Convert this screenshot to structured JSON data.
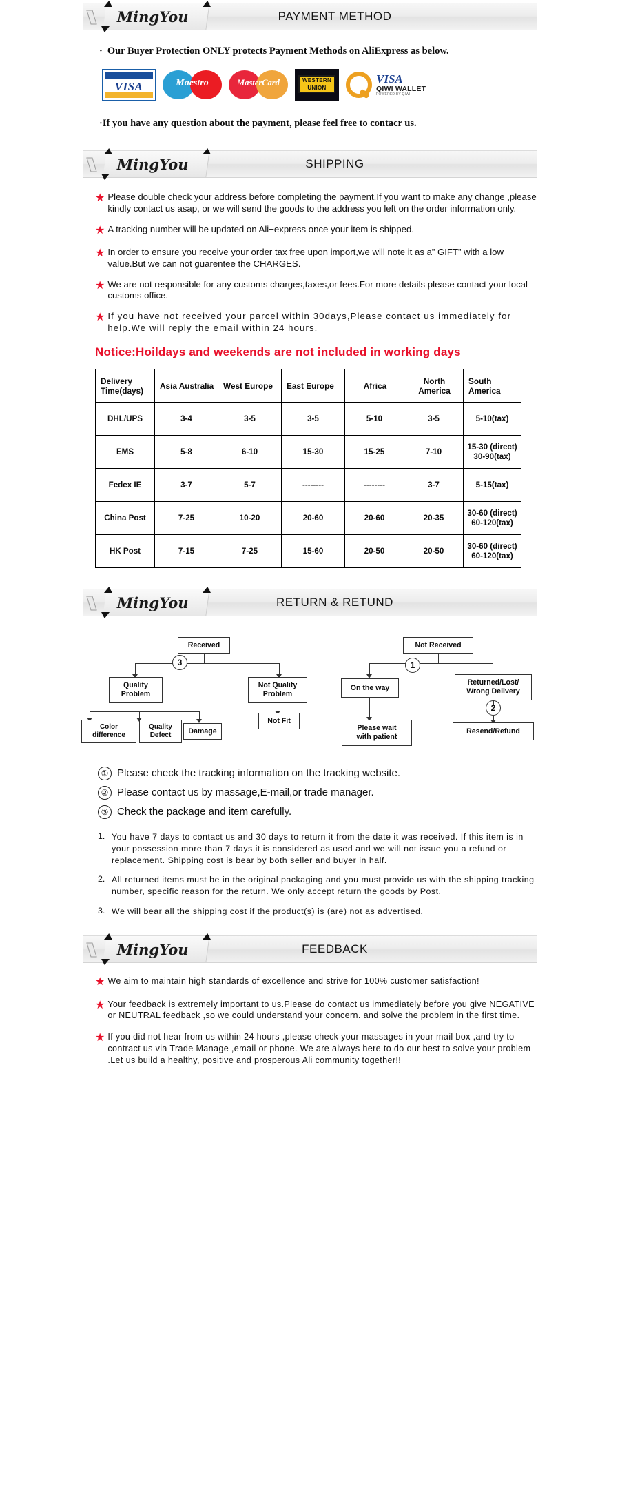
{
  "brand": "MingYou",
  "sections": {
    "payment": {
      "title": "PAYMENT METHOD",
      "line1": "Our Buyer Protection ONLY protects Payment Methods on AliExpress as below.",
      "line2": "If you have any question about the payment, please feel free to contacr us.",
      "bullet": "·",
      "logos": [
        {
          "name": "visa-logo",
          "text": "VISA"
        },
        {
          "name": "maestro-logo",
          "text": "Maestro"
        },
        {
          "name": "mastercard-logo",
          "text": "MasterCard"
        },
        {
          "name": "western-union-logo",
          "text_top": "WESTERN",
          "text_bottom": "UNION"
        },
        {
          "name": "qiwi-wallet-logo",
          "text": "VISA",
          "sub": "QIWI WALLET",
          "fine": "POWERED BY QIWI"
        }
      ]
    },
    "shipping": {
      "title": "SHIPPING",
      "bullets": [
        "Please double check your address before completing the payment.If you want to make any change ,please kindly contact us asap, or we will send the goods to the address you left on the order information only.",
        "A tracking number will be updated on Ali−express once your item is shipped.",
        "In order to ensure you receive your order tax free upon import,we will note it as a” GIFT” with a low value.But we can not guarentee the CHARGES.",
        "We are not responsible for any customs charges,taxes,or fees.For more details please contact your local customs office.",
        "If you have not received your parcel within 30days,Please contact us immediately for help.We will reply the email within 24 hours."
      ],
      "notice": "Notice:Hoildays and weekends are not included in working days",
      "table": {
        "headers": [
          "Delivery Time(days)",
          "Asia Australia",
          "West Europe",
          "East Europe",
          "Africa",
          "North America",
          "South America"
        ],
        "rows": [
          {
            "method": "DHL/UPS",
            "cells": [
              "3-4",
              "3-5",
              "3-5",
              "5-10",
              "3-5",
              "5-10(tax)"
            ]
          },
          {
            "method": "EMS",
            "cells": [
              "5-8",
              "6-10",
              "15-30",
              "15-25",
              "7-10",
              "15-30\n(direct)\n30-90(tax)"
            ]
          },
          {
            "method": "Fedex IE",
            "cells": [
              "3-7",
              "5-7",
              "--------",
              "--------",
              "3-7",
              "5-15(tax)"
            ]
          },
          {
            "method": "China Post",
            "cells": [
              "7-25",
              "10-20",
              "20-60",
              "20-60",
              "20-35",
              "30-60\n(direct)\n60-120(tax)"
            ]
          },
          {
            "method": "HK Post",
            "cells": [
              "7-15",
              "7-25",
              "15-60",
              "20-50",
              "20-50",
              "30-60\n(direct)\n60-120(tax)"
            ]
          }
        ]
      }
    },
    "returns": {
      "title": "RETURN & RETUND",
      "diagram": {
        "nodes": [
          {
            "id": "received",
            "label": "Received"
          },
          {
            "id": "quality-problem",
            "label": "Quality\nProblem"
          },
          {
            "id": "not-quality-problem",
            "label": "Not Quality\nProblem"
          },
          {
            "id": "color-difference",
            "label": "Color\ndifference"
          },
          {
            "id": "quality-defect",
            "label": "Quality\nDefect"
          },
          {
            "id": "damage",
            "label": "Damage"
          },
          {
            "id": "not-fit",
            "label": "Not Fit"
          },
          {
            "id": "not-received",
            "label": "Not  Received"
          },
          {
            "id": "on-the-way",
            "label": "On the way"
          },
          {
            "id": "returned-lost-wrong",
            "label": "Returned/Lost/\nWrong Delivery"
          },
          {
            "id": "please-wait",
            "label": "Please wait\nwith patient"
          },
          {
            "id": "resend-refund",
            "label": "Resend/Refund"
          }
        ],
        "markers": [
          "1",
          "2",
          "3"
        ]
      },
      "notes": [
        {
          "num": "①",
          "text": "Please check the tracking information on the tracking website."
        },
        {
          "num": "②",
          "text": "Please contact us by  massage,E-mail,or trade manager."
        },
        {
          "num": "③",
          "text": "Check the package and item carefully."
        }
      ],
      "policies": [
        {
          "num": "1.",
          "text": "You have 7 days to contact us and 30 days to return it from the date it was received. If this item is in your possession more than 7 days,it is considered as used and we will not issue you a refund or replacement. Shipping cost is bear by both seller and buyer in half."
        },
        {
          "num": "2.",
          "text": "All returned items must be in the original packaging and you must provide us with the shipping tracking number, specific reason for the return. We only accept return the goods by Post."
        },
        {
          "num": "3.",
          "text": "We will bear all the shipping cost if the product(s) is (are) not as advertised."
        }
      ]
    },
    "feedback": {
      "title": "FEEDBACK",
      "items": [
        "We aim to maintain high standards of excellence and strive  for 100% customer satisfaction!",
        "Your feedback is extremely important to us.Please do contact us immediately before you give NEGATIVE or NEUTRAL feedback ,so  we could understand your concern. and solve the problem in the first time.",
        "If you did not hear from us within 24 hours ,please check your massages in your mail box ,and try to contract us via Trade Manage ,email or phone. We are always here to do our best to solve your problem .Let us build a healthy, positive and prosperous Ali community together!!"
      ]
    }
  },
  "colors": {
    "red": "#e8102a",
    "banner_bg": "#ececec",
    "border": "#000000"
  }
}
